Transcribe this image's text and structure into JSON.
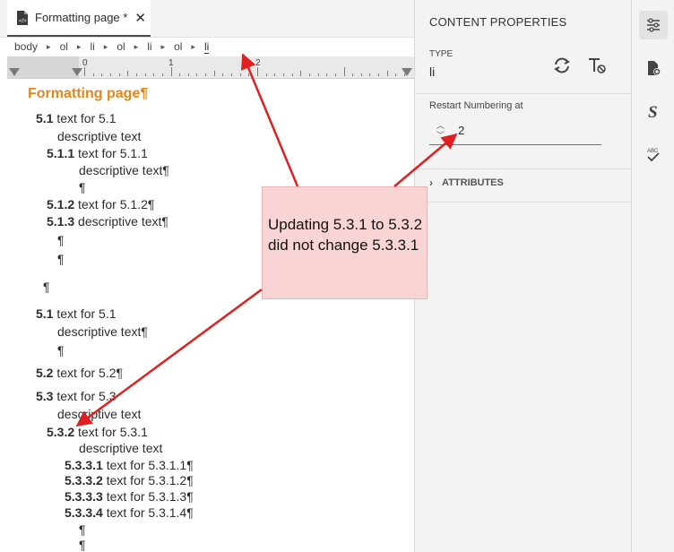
{
  "tab": {
    "title": "Formatting page *",
    "close": "✕"
  },
  "breadcrumb": [
    "body",
    "ol",
    "li",
    "ol",
    "li",
    "ol",
    "li"
  ],
  "breadcrumb_sep": "▸",
  "ruler": {
    "n0": "0",
    "n1": "1",
    "n2": "2"
  },
  "doc": {
    "heading": "Formatting page¶",
    "lines": [
      {
        "num": "5.1",
        "text": " text for 5.1"
      },
      {
        "text": "descriptive text"
      },
      {
        "num": "5.1.1",
        "text": " text for 5.1.1"
      },
      {
        "text": "descriptive text¶"
      },
      {
        "text": "¶"
      },
      {
        "num": "5.1.2",
        "text": " text for 5.1.2¶"
      },
      {
        "num": "5.1.3",
        "text": " descriptive text¶"
      },
      {
        "text": "¶"
      },
      {
        "text": "¶"
      },
      {
        "text": "¶"
      },
      {
        "num": "5.1",
        "text": " text for 5.1"
      },
      {
        "text": "descriptive text¶"
      },
      {
        "text": "¶"
      },
      {
        "num": "5.2",
        "text": " text for 5.2¶"
      },
      {
        "num": "5.3",
        "text": " text for 5.3"
      },
      {
        "text": "descriptive text"
      },
      {
        "num": "5.3.2",
        "text": " text for 5.3.1"
      },
      {
        "text": "descriptive text"
      },
      {
        "num": "5.3.3.1",
        "text": " text for 5.3.1.1¶"
      },
      {
        "num": "5.3.3.2",
        "text": " text for 5.3.1.2¶"
      },
      {
        "num": "5.3.3.3",
        "text": " text for 5.3.1.3¶"
      },
      {
        "num": "5.3.3.4",
        "text": " text for 5.3.1.4¶"
      },
      {
        "text": "¶"
      },
      {
        "text": "¶"
      }
    ]
  },
  "panel": {
    "title": "CONTENT PROPERTIES",
    "type_label": "TYPE",
    "type_value": "li",
    "restart_label": "Restart Numbering at",
    "restart_value": "2",
    "attributes_label": "ATTRIBUTES"
  },
  "annotation": {
    "text": "Updating 5.3.1 to 5.3.2 did not change 5.3.3.1"
  },
  "colors": {
    "heading": "#e68619",
    "arrow": "#e02020",
    "callout": "#f8d4d4",
    "focus": "#2680eb"
  },
  "icons": [
    "document-icon",
    "refresh-icon",
    "clear-format-icon",
    "properties-icon",
    "page-settings-icon",
    "styles-icon",
    "spellcheck-icon"
  ]
}
